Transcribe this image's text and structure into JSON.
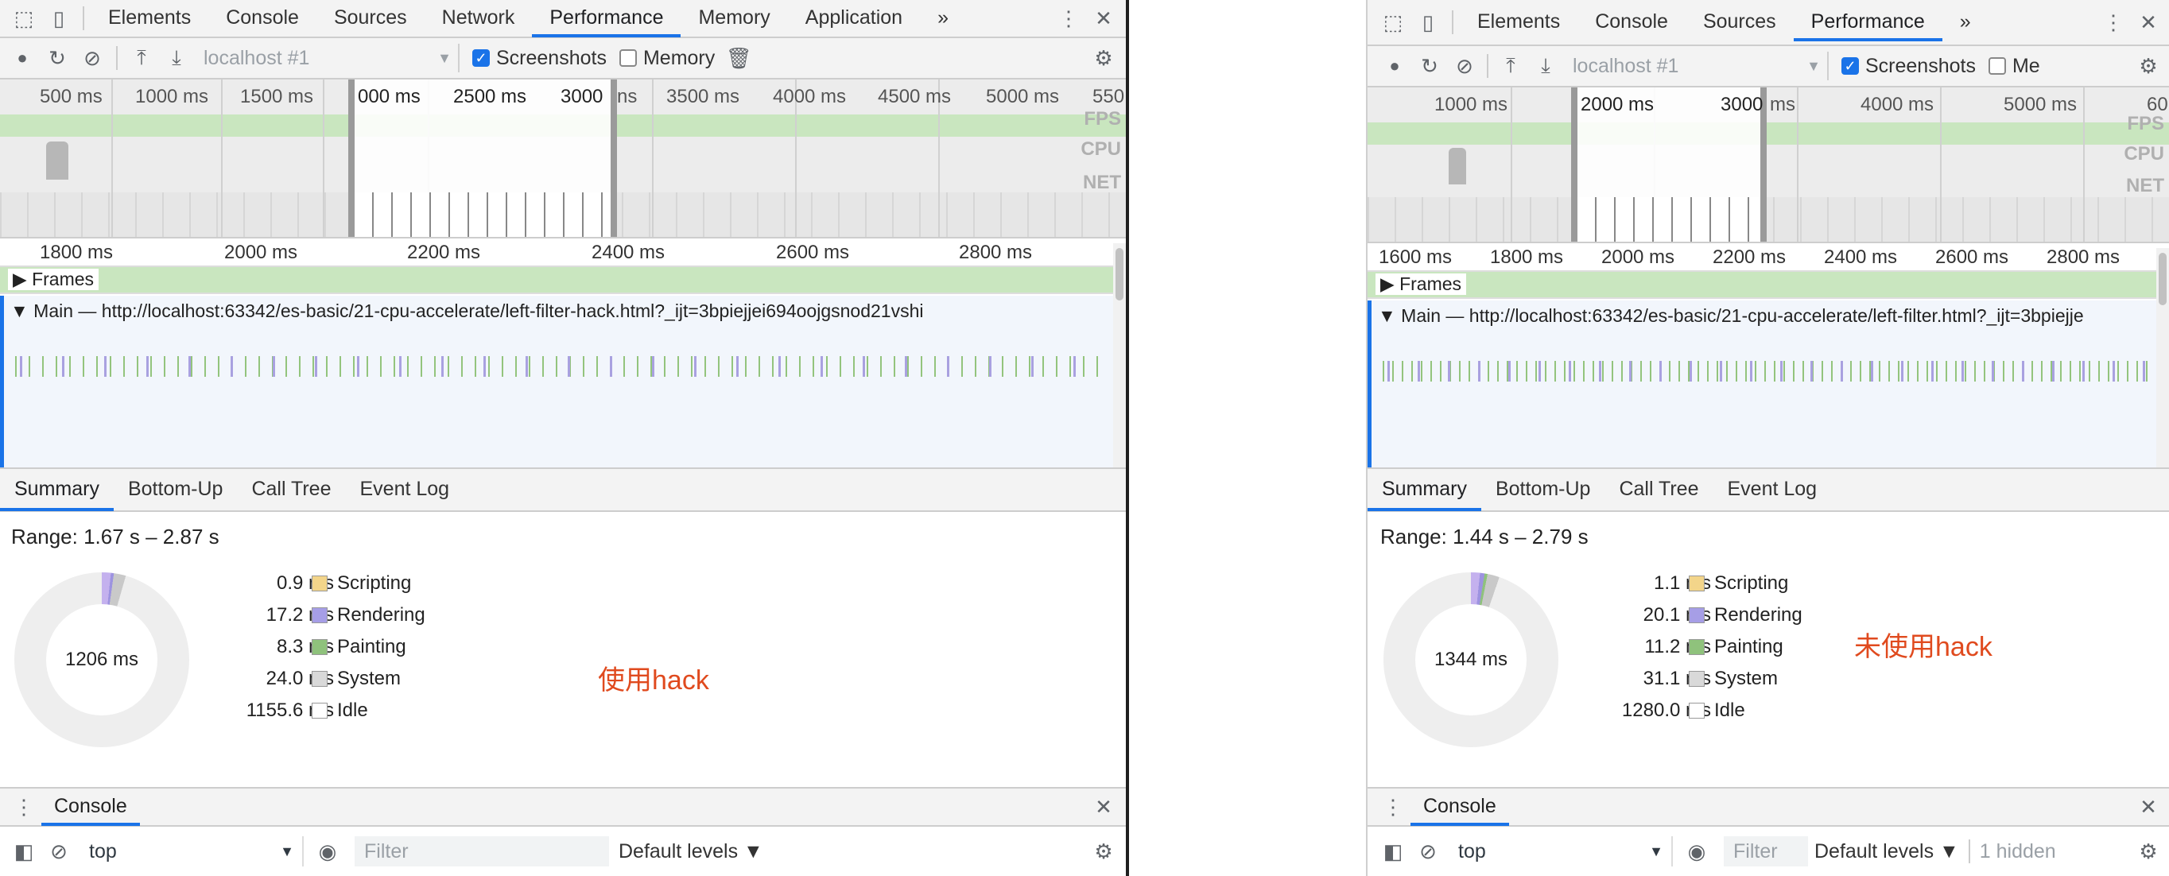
{
  "tabs": [
    "Elements",
    "Console",
    "Sources",
    "Network",
    "Performance",
    "Memory",
    "Application"
  ],
  "more_tabs_glyph": "»",
  "toolbar": {
    "target": "localhost #1",
    "screenshots_label": "Screenshots",
    "memory_label": "Memory",
    "memory_label_cut": "Me"
  },
  "left": {
    "overview_labels": [
      "500 ms",
      "1000 ms",
      "1500 ms",
      "000 ms",
      "2500 ms",
      "3000",
      "ns",
      "3500 ms",
      "4000 ms",
      "4500 ms",
      "5000 ms",
      "550"
    ],
    "timeline_labels": [
      "1800 ms",
      "2000 ms",
      "2200 ms",
      "2400 ms",
      "2600 ms",
      "2800 ms"
    ],
    "main_label": "Main — http://localhost:63342/es-basic/21-cpu-accelerate/left-filter-hack.html?_ijt=3bpiejjei694oojgsnod21vshi",
    "range": "Range: 1.67 s – 2.87 s",
    "total": "1206 ms",
    "breakdown": [
      {
        "value": "0.9 ms",
        "label": "Scripting",
        "color": "#f3d58a"
      },
      {
        "value": "17.2 ms",
        "label": "Rendering",
        "color": "#a69ee6"
      },
      {
        "value": "8.3 ms",
        "label": "Painting",
        "color": "#8fc27c"
      },
      {
        "value": "24.0 ms",
        "label": "System",
        "color": "#d9d9d9"
      },
      {
        "value": "1155.6 ms",
        "label": "Idle",
        "color": "#ffffff"
      }
    ],
    "note": "使用hack",
    "console": {
      "context": "top",
      "filter_placeholder": "Filter",
      "levels": "Default levels ▼"
    }
  },
  "right": {
    "overview_labels": [
      "1000 ms",
      "2000 ms",
      "3000",
      "ms",
      "4000 ms",
      "5000 ms",
      "60"
    ],
    "timeline_labels": [
      "1600 ms",
      "1800 ms",
      "2000 ms",
      "2200 ms",
      "2400 ms",
      "2600 ms",
      "2800 ms"
    ],
    "main_label": "Main — http://localhost:63342/es-basic/21-cpu-accelerate/left-filter.html?_ijt=3bpiejje",
    "range": "Range: 1.44 s – 2.79 s",
    "total": "1344 ms",
    "breakdown": [
      {
        "value": "1.1 ms",
        "label": "Scripting",
        "color": "#f3d58a"
      },
      {
        "value": "20.1 ms",
        "label": "Rendering",
        "color": "#a69ee6"
      },
      {
        "value": "11.2 ms",
        "label": "Painting",
        "color": "#8fc27c"
      },
      {
        "value": "31.1 ms",
        "label": "System",
        "color": "#d9d9d9"
      },
      {
        "value": "1280.0 ms",
        "label": "Idle",
        "color": "#ffffff"
      }
    ],
    "note": "未使用hack",
    "console": {
      "context": "top",
      "filter_placeholder": "Filter",
      "levels": "Default levels ▼",
      "hidden": "1 hidden"
    }
  },
  "strip_labels": {
    "fps": "FPS",
    "cpu": "CPU",
    "net": "NET"
  },
  "frames_label": "Frames",
  "subtabs": [
    "Summary",
    "Bottom-Up",
    "Call Tree",
    "Event Log"
  ],
  "drawer_tab": "Console",
  "icons": [
    "inspect-icon",
    "device-icon",
    "kebab-menu-icon",
    "close-icon",
    "record-icon",
    "reload-icon",
    "clear-icon",
    "upload-icon",
    "download-icon",
    "trash-icon",
    "gear-icon",
    "sidebar-icon",
    "block-icon",
    "eye-icon"
  ]
}
